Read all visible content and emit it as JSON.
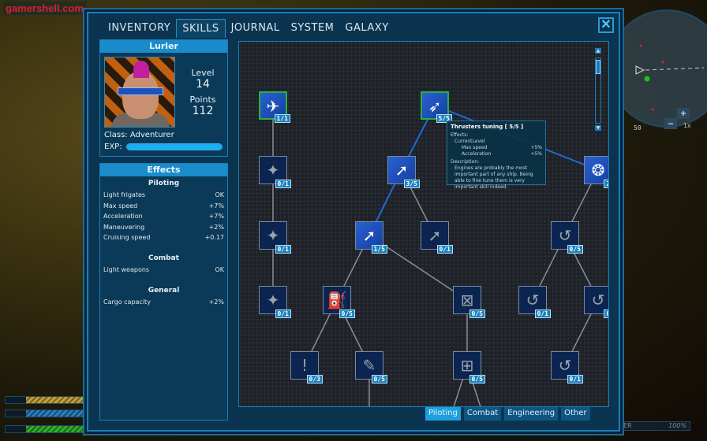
{
  "watermark": "gamershell.com",
  "tabs": [
    {
      "label": "INVENTORY"
    },
    {
      "label": "SKILLS",
      "active": true
    },
    {
      "label": "JOURNAL"
    },
    {
      "label": "SYSTEM"
    },
    {
      "label": "GALAXY"
    }
  ],
  "close_label": "✕",
  "character": {
    "name": "Lurler",
    "level_label": "Level",
    "level": "14",
    "points_label": "Points",
    "points": "112",
    "class": "Class: Adventurer",
    "exp_label": "EXP:",
    "exp_progress": 1.0
  },
  "effects": {
    "title": "Effects",
    "groups": [
      {
        "name": "Piloting",
        "rows": [
          {
            "k": "Light frigates",
            "v": "OK"
          },
          {
            "k": "Max speed",
            "v": "+7%"
          },
          {
            "k": "Acceleration",
            "v": "+7%"
          },
          {
            "k": "Maneuvering",
            "v": "+2%"
          },
          {
            "k": "Cruising speed",
            "v": "+0.17"
          }
        ]
      },
      {
        "name": "Combat",
        "rows": [
          {
            "k": "Light weapons",
            "v": "OK"
          }
        ]
      },
      {
        "name": "General",
        "rows": [
          {
            "k": "Cargo capacity",
            "v": "+2%"
          }
        ]
      }
    ]
  },
  "skills": [
    {
      "level": "1/1",
      "state": "done",
      "icon": "ship-icon"
    },
    {
      "level": "5/5",
      "state": "done",
      "icon": "thruster-icon"
    },
    {
      "level": "0/1",
      "state": "locked",
      "icon": "frigate-icon"
    },
    {
      "level": "3/5",
      "state": "active",
      "icon": "speed-ship-icon"
    },
    {
      "level": "2/",
      "state": "active",
      "icon": "engine-icon"
    },
    {
      "level": "0/1",
      "state": "locked",
      "icon": "frigate-icon"
    },
    {
      "level": "1/5",
      "state": "active",
      "icon": "speed-ship-icon"
    },
    {
      "level": "0/1",
      "state": "locked",
      "icon": "speed-ship-icon"
    },
    {
      "level": "0/5",
      "state": "locked",
      "icon": "maneuver-icon"
    },
    {
      "level": "0/1",
      "state": "locked",
      "icon": "frigate-icon"
    },
    {
      "level": "0/5",
      "state": "locked",
      "icon": "fuel-can-icon"
    },
    {
      "level": "0/5",
      "state": "locked",
      "icon": "cargo-crate-icon"
    },
    {
      "level": "0/1",
      "state": "locked",
      "icon": "maneuver-icon"
    },
    {
      "level": "0/",
      "state": "locked",
      "icon": "maneuver-icon"
    },
    {
      "level": "0/3",
      "state": "locked",
      "icon": "warning-icon"
    },
    {
      "level": "0/5",
      "state": "locked",
      "icon": "repair-icon"
    },
    {
      "level": "0/5",
      "state": "locked",
      "icon": "cargo-crates-icon"
    },
    {
      "level": "0/1",
      "state": "locked",
      "icon": "maneuver-icon"
    }
  ],
  "tooltip": {
    "title": "Thrusters tuning  [ 5/5 ]",
    "effects_label": "Effects:",
    "current_label": "CurrentLevel",
    "rows": [
      {
        "k": "Max speed",
        "v": "+5%"
      },
      {
        "k": "Acceleration",
        "v": "+5%"
      }
    ],
    "desc_label": "Description:",
    "desc": "Engines are probably the most important part of any ship. Being able to fine tune them is very important skill indeed."
  },
  "categories": [
    {
      "label": "Piloting",
      "active": true
    },
    {
      "label": "Combat"
    },
    {
      "label": "Engineering"
    },
    {
      "label": "Other"
    }
  ],
  "minimap": {
    "distance": "50",
    "zoom": "1x",
    "plus": "+",
    "minus": "−"
  },
  "hud": {
    "right_label": "ER",
    "right_value": "100%"
  },
  "colors": {
    "accent": "#1b8ccb",
    "active_line": "#1e6ad8",
    "done_border": "#2ab040",
    "energy": "#c8a030",
    "shield": "#2a80c0",
    "hull": "#30b030"
  }
}
